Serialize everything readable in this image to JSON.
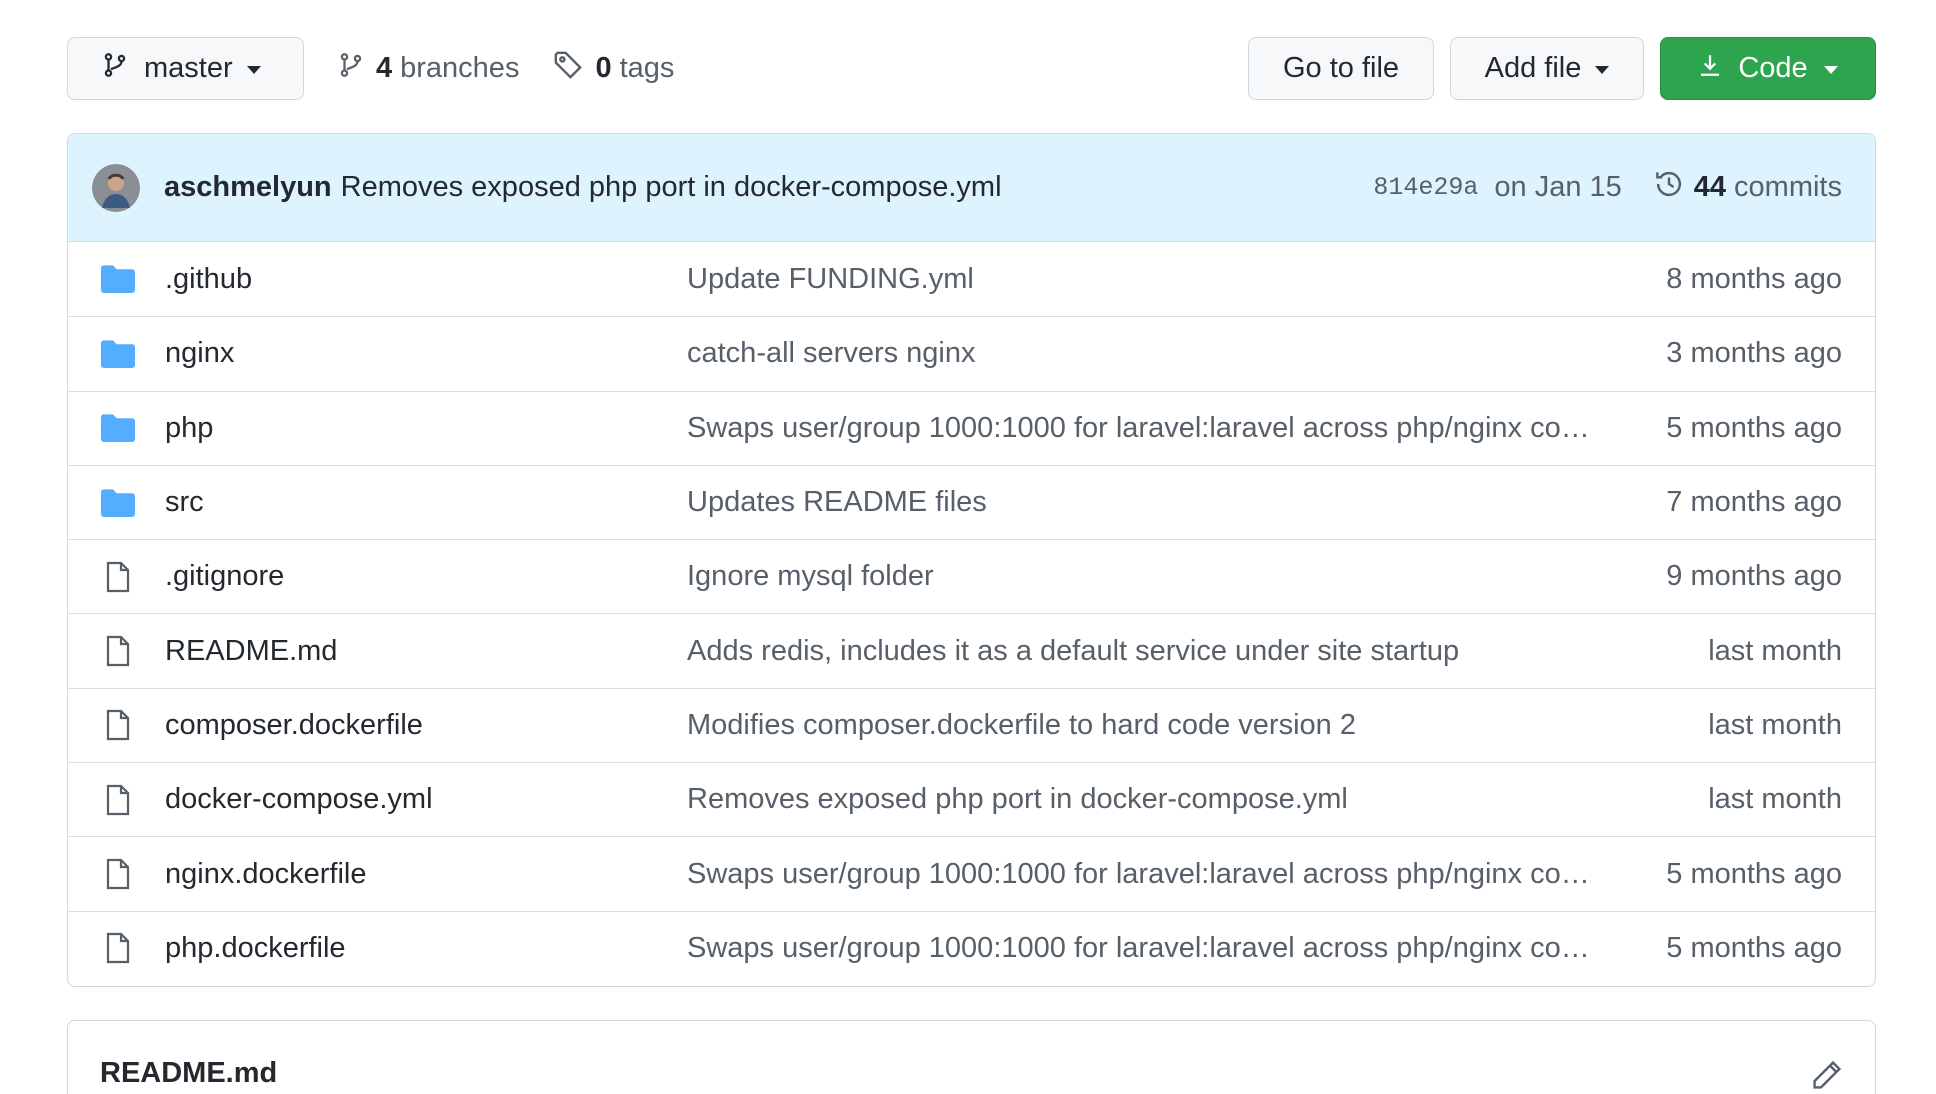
{
  "toolbar": {
    "branch_label": "master",
    "branches_count": "4",
    "branches_label": "branches",
    "tags_count": "0",
    "tags_label": "tags",
    "goto_label": "Go to file",
    "add_label": "Add file",
    "code_label": "Code",
    "code_color": "#2da44e"
  },
  "commit": {
    "author": "aschmelyun",
    "message": "Removes exposed php port in docker-compose.yml",
    "sha": "814e29a",
    "date": "on Jan 15",
    "count": "44",
    "count_label": "commits"
  },
  "files": [
    {
      "icon": "folder-icon",
      "name": ".github",
      "message": "Update FUNDING.yml",
      "age": "8 months ago"
    },
    {
      "icon": "folder-icon",
      "name": "nginx",
      "message": "catch-all servers nginx",
      "age": "3 months ago"
    },
    {
      "icon": "folder-icon",
      "name": "php",
      "message": "Swaps user/group 1000:1000 for laravel:laravel across php/nginx cont…",
      "age": "5 months ago"
    },
    {
      "icon": "folder-icon",
      "name": "src",
      "message": "Updates README files",
      "age": "7 months ago"
    },
    {
      "icon": "file-icon",
      "name": ".gitignore",
      "message": "Ignore mysql folder",
      "age": "9 months ago"
    },
    {
      "icon": "file-icon",
      "name": "README.md",
      "message": "Adds redis, includes it as a default service under site startup",
      "age": "last month"
    },
    {
      "icon": "file-icon",
      "name": "composer.dockerfile",
      "message": "Modifies composer.dockerfile to hard code version 2",
      "age": "last month"
    },
    {
      "icon": "file-icon",
      "name": "docker-compose.yml",
      "message": "Removes exposed php port in docker-compose.yml",
      "age": "last month"
    },
    {
      "icon": "file-icon",
      "name": "nginx.dockerfile",
      "message": "Swaps user/group 1000:1000 for laravel:laravel across php/nginx cont…",
      "age": "5 months ago"
    },
    {
      "icon": "file-icon",
      "name": "php.dockerfile",
      "message": "Swaps user/group 1000:1000 for laravel:laravel across php/nginx cont…",
      "age": "5 months ago"
    }
  ],
  "readme": {
    "title": "README.md"
  }
}
